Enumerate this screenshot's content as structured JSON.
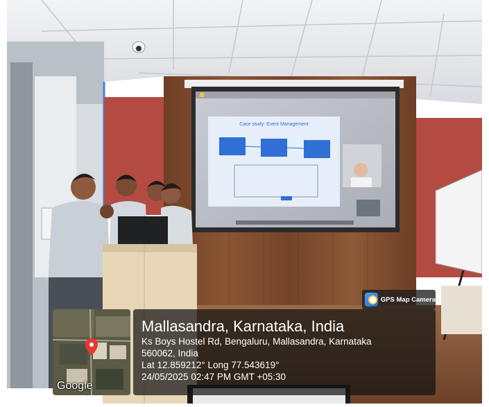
{
  "overlay": {
    "badge_label": "GPS Map Camera",
    "location_title": "Mallasandra, Karnataka, India",
    "address_line1": "Ks Boys Hostel Rd, Bengaluru, Mallasandra, Karnataka",
    "address_line2": "560062, India",
    "coordinates": "Lat 12.859212° Long 77.543619°",
    "timestamp": "24/05/2025 02:47 PM GMT +05:30",
    "map_provider": "Google"
  },
  "projection": {
    "slide_title": "Case study: Event Management"
  },
  "colors": {
    "wall_wood": "#7a4a2c",
    "wall_red": "#b34b42",
    "ceiling": "#e9ecef",
    "slide_blue": "#2f6fd6",
    "map_pin": "#e53935"
  }
}
